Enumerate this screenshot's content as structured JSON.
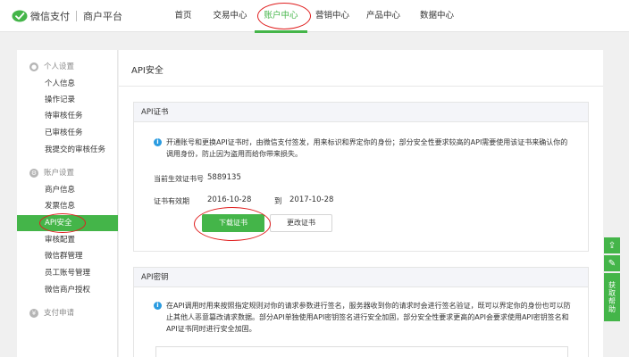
{
  "header": {
    "brand": "微信支付",
    "subtitle": "商户平台",
    "nav": [
      {
        "label": "首页",
        "left": 0
      },
      {
        "label": "交易中心"
      },
      {
        "label": "账户中心",
        "active": true
      },
      {
        "label": "营销中心"
      },
      {
        "label": "产品中心"
      },
      {
        "label": "数据中心"
      }
    ]
  },
  "sidebar": {
    "group_personal": "个人设置",
    "personal_items": [
      "个人信息",
      "操作记录",
      "待审核任务",
      "已审核任务",
      "我提交的审核任务"
    ],
    "group_account": "账户设置",
    "account_items": [
      "商户信息",
      "发票信息",
      "API安全",
      "审核配置",
      "微信群管理",
      "员工账号管理",
      "微信商户授权"
    ],
    "group_payment": "支付申请"
  },
  "main": {
    "title": "API安全",
    "cert_section": {
      "heading": "API证书",
      "info": "开通账号和更换API证书时，由微信支付签发，用来标识和界定你的身份；部分安全性要求较高的API需要使用该证书来确认你的调用身份，防止因为盗用而给你带来损失。",
      "serial_label": "当前生效证书号",
      "serial_value": "5889135",
      "validity_label": "证书有效期",
      "valid_from": "2016-10-28",
      "to_text": "到",
      "valid_to": "2017-10-28",
      "download_label": "下载证书",
      "change_label": "更改证书"
    },
    "key_section": {
      "heading": "API密钥",
      "info": "在API调用时用来按照指定规则对你的请求参数进行签名，服务器收到你的请求时会进行签名验证，既可以界定你的身份也可以防止其他人恶意篡改请求数据。部分API单独使用API密钥签名进行安全加固，部分安全性要求更高的API会要求使用API密钥签名和API证书同时进行安全加固。"
    }
  },
  "float_tools": {
    "help_label": "获取帮助"
  },
  "colors": {
    "accent": "#44b549",
    "annotation": "#e02020",
    "info": "#2a9be0"
  }
}
